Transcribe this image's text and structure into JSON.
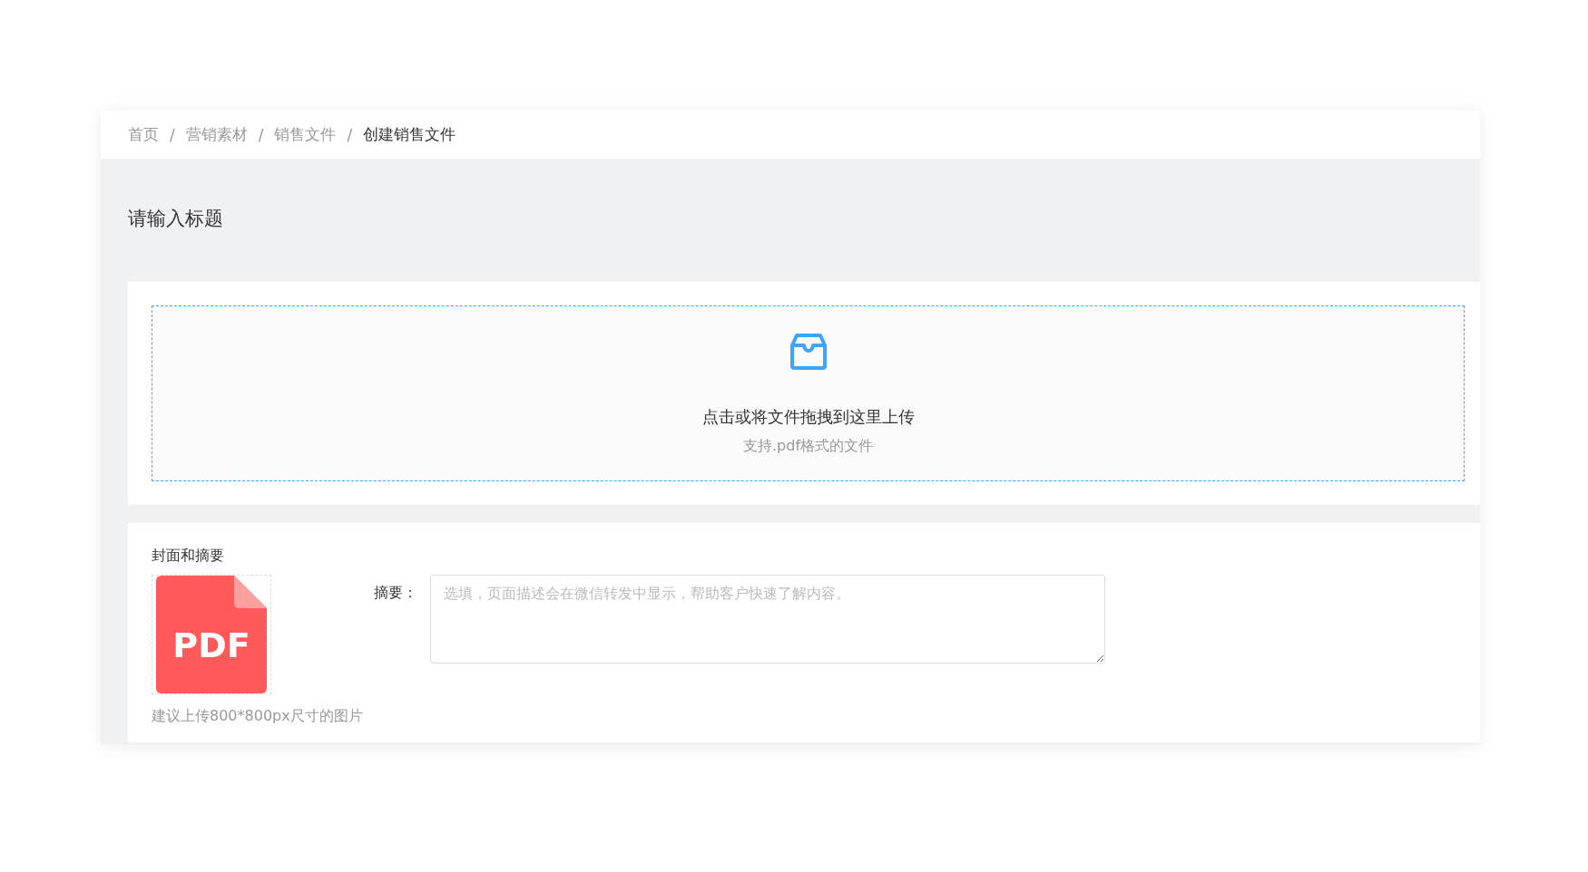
{
  "breadcrumb": [
    {
      "label": "首页",
      "selected": false
    },
    {
      "label": "营销素材",
      "selected": false
    },
    {
      "label": "销售文件",
      "selected": false
    },
    {
      "label": "创建销售文件",
      "selected": true
    }
  ],
  "breadcrumb_separator": "/",
  "title": "请输入标题",
  "upload": {
    "text": "点击或将文件拖拽到这里上传",
    "hint": "支持.pdf格式的文件"
  },
  "cover": {
    "heading": "封面和摘要",
    "file_label": "PDF",
    "hint": "建议上传800*800px尺寸的图片"
  },
  "summary": {
    "label": "摘要：",
    "placeholder": "选填，页面描述会在微信转发中显示，帮助客户快速了解内容。"
  }
}
